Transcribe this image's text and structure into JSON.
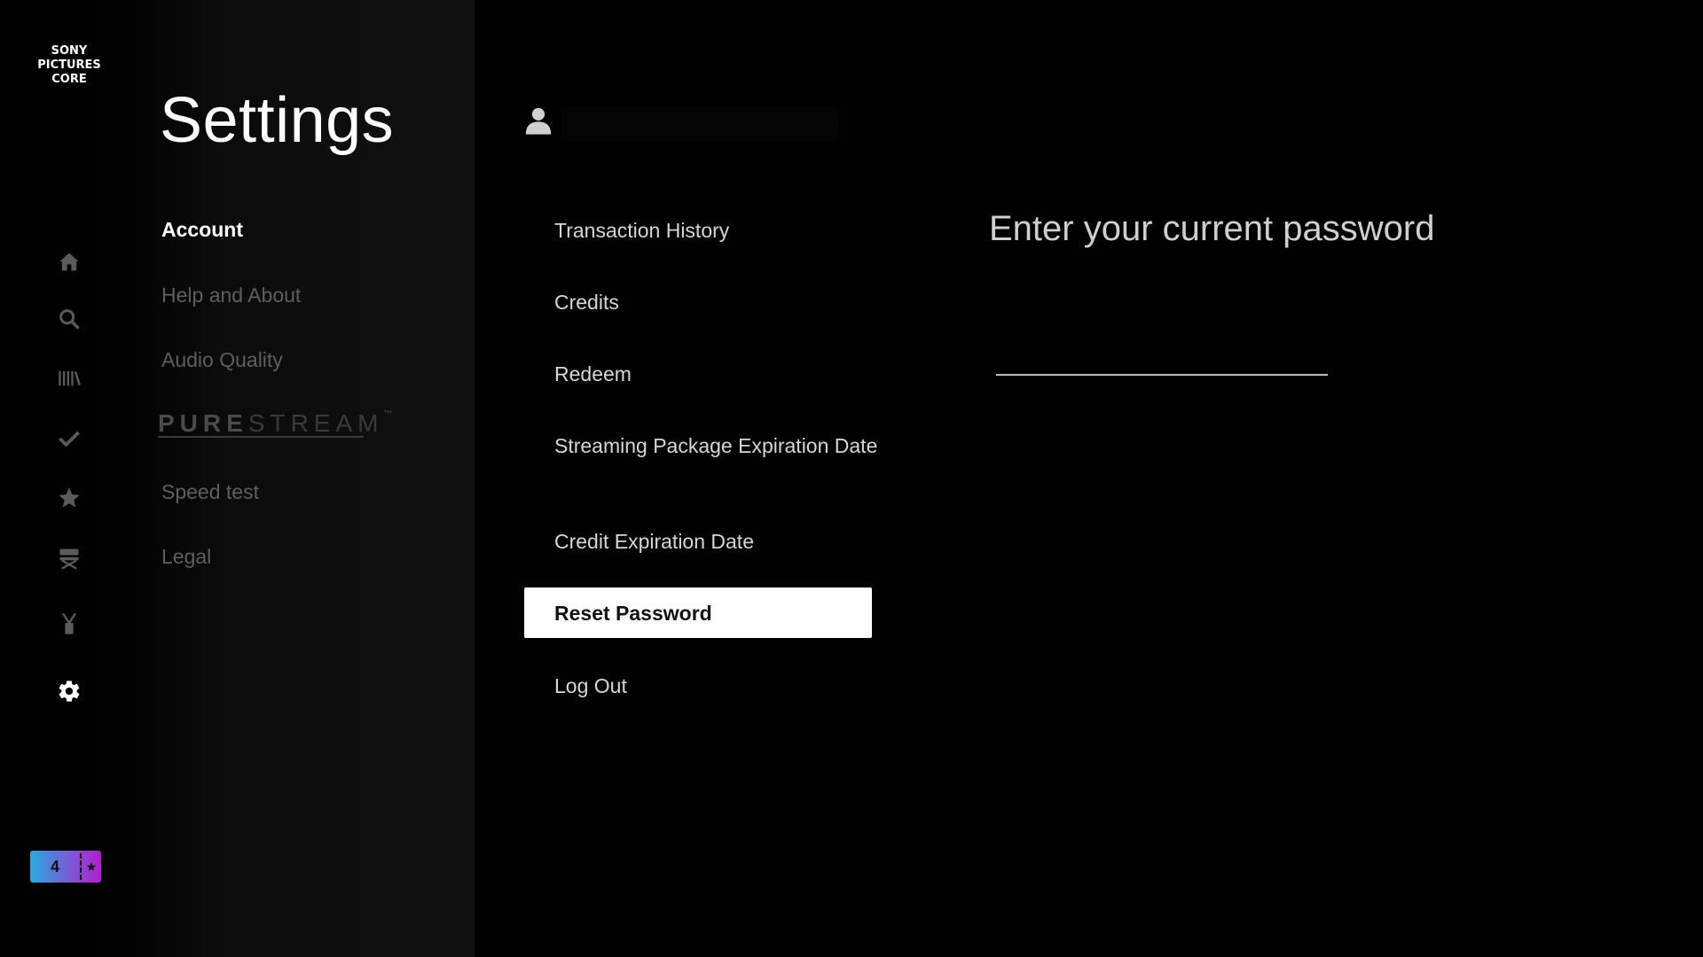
{
  "brand": {
    "logo_lines": [
      "SONY",
      "PICTURES",
      "CORE"
    ]
  },
  "nav_rail": [
    {
      "icon": "home-icon"
    },
    {
      "icon": "search-icon"
    },
    {
      "icon": "library-icon"
    },
    {
      "icon": "check-icon"
    },
    {
      "icon": "star-icon"
    },
    {
      "icon": "director-chair-icon"
    },
    {
      "icon": "clapper-icon"
    },
    {
      "icon": "gear-icon",
      "active": true
    }
  ],
  "ticket_badge": {
    "count": "4",
    "star": "★"
  },
  "page_title": "Settings",
  "categories": [
    {
      "label": "Account",
      "active": true
    },
    {
      "label": "Help and About"
    },
    {
      "label": "Audio Quality"
    },
    {
      "label": "Speed test"
    },
    {
      "label": "Legal"
    }
  ],
  "purestream": {
    "bold": "PURE",
    "thin": "STREAM",
    "tm": "™"
  },
  "account_menu": [
    {
      "label": "Transaction History"
    },
    {
      "label": "Credits"
    },
    {
      "label": "Redeem"
    },
    {
      "label": "Streaming Package Expiration Date"
    },
    {
      "label": "Credit Expiration Date"
    },
    {
      "label": "Reset Password",
      "selected": true
    },
    {
      "label": "Log Out"
    }
  ],
  "reset_password": {
    "prompt": "Enter your current password",
    "value": ""
  },
  "colors": {
    "background": "#000000",
    "selected_bg": "#ffffff",
    "inactive_text": "#5e5e5e",
    "ticket_gradient": [
      "#2aa9e0",
      "#b21ed0"
    ]
  }
}
